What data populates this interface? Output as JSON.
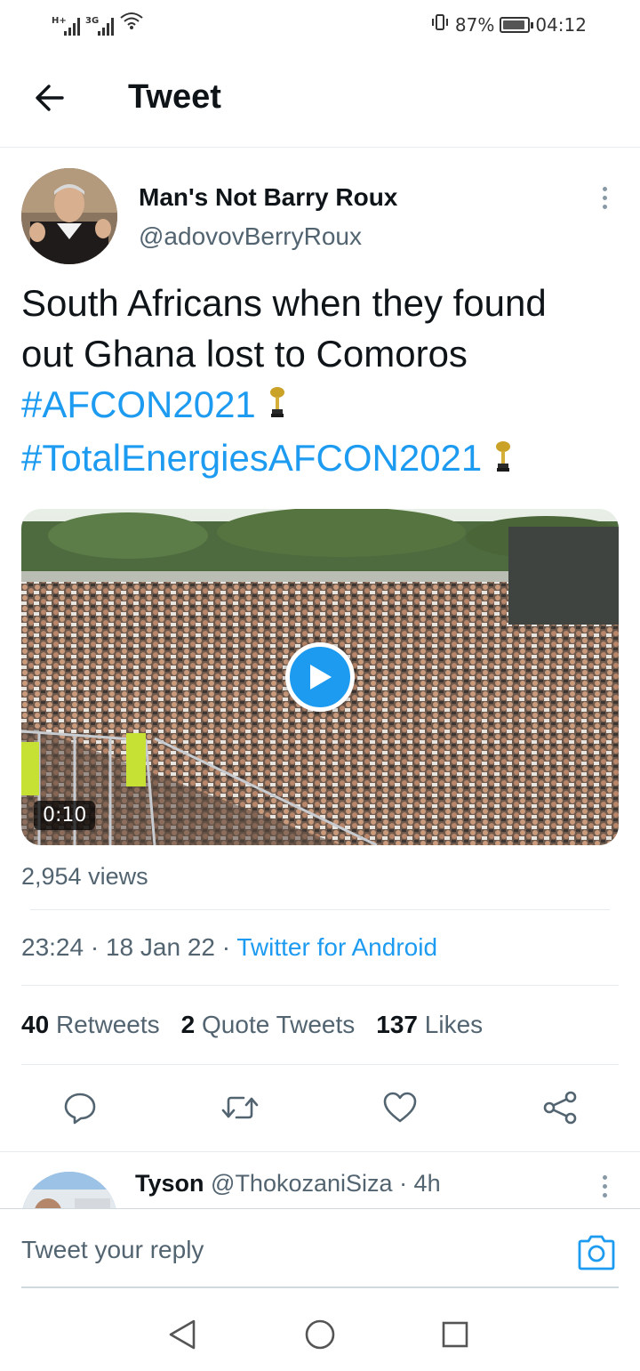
{
  "status_bar": {
    "network1": "H+",
    "network2": "3G",
    "battery_percent": "87%",
    "time": "04:12"
  },
  "header": {
    "title": "Tweet",
    "back_icon": "arrow-left-icon"
  },
  "tweet": {
    "author_name": "Man's Not Barry Roux",
    "author_handle": "@adovovBerryRoux",
    "text_line1": "South Africans when they found",
    "text_line2": "out Ghana lost to Comoros",
    "hashtag1": "#AFCON2021",
    "hashtag2": "#TotalEnergiesAFCON2021",
    "hashtag_emoji": "trophy-icon",
    "video_duration": "0:10",
    "views": "2,954 views",
    "time": "23:24",
    "date": "18 Jan 22",
    "separator": "·",
    "source": "Twitter for Android",
    "retweets_count": "40",
    "retweets_label": "Retweets",
    "quote_count": "2",
    "quote_label": "Quote Tweets",
    "likes_count": "137",
    "likes_label": "Likes"
  },
  "actions": [
    "reply-icon",
    "retweet-icon",
    "like-icon",
    "share-icon"
  ],
  "reply_preview": {
    "name": "Tyson",
    "handle": "@ThokozaniSiza",
    "age": "· 4h"
  },
  "composer": {
    "placeholder": "Tweet your reply"
  },
  "colors": {
    "accent": "#1d9bf0",
    "text": "#0f1419",
    "secondary": "#536471",
    "divider": "#e6ecf0"
  }
}
